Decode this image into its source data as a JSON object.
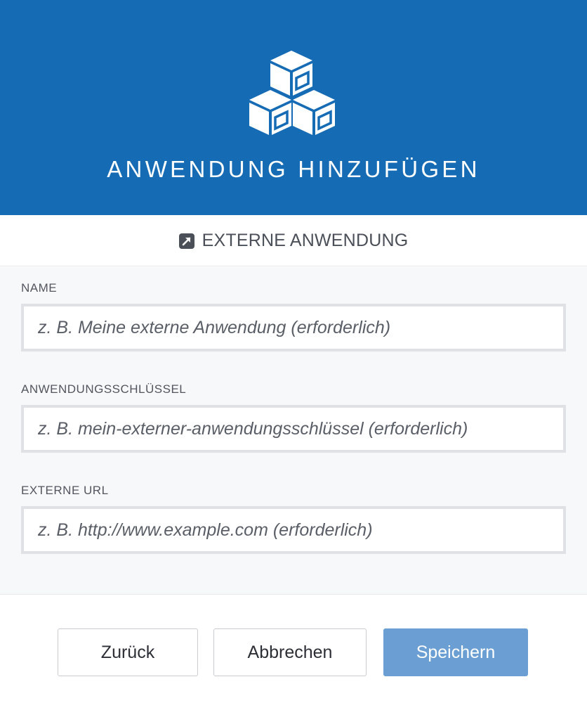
{
  "header": {
    "title": "ANWENDUNG HINZUFÜGEN",
    "logo_icon": "cubes-icon",
    "background_color": "#166bb5"
  },
  "subheader": {
    "icon": "external-link-icon",
    "label": "EXTERNE ANWENDUNG"
  },
  "form": {
    "name": {
      "label": "NAME",
      "placeholder": "z. B. Meine externe Anwendung (erforderlich)",
      "value": ""
    },
    "app_key": {
      "label": "ANWENDUNGSSCHLÜSSEL",
      "placeholder": "z. B. mein-externer-anwendungsschlüssel (erforderlich)",
      "value": ""
    },
    "external_url": {
      "label": "EXTERNE URL",
      "placeholder": "z. B. http://www.example.com (erforderlich)",
      "value": ""
    }
  },
  "footer": {
    "back_label": "Zurück",
    "cancel_label": "Abbrechen",
    "save_label": "Speichern",
    "save_color": "#6b9fd3"
  }
}
